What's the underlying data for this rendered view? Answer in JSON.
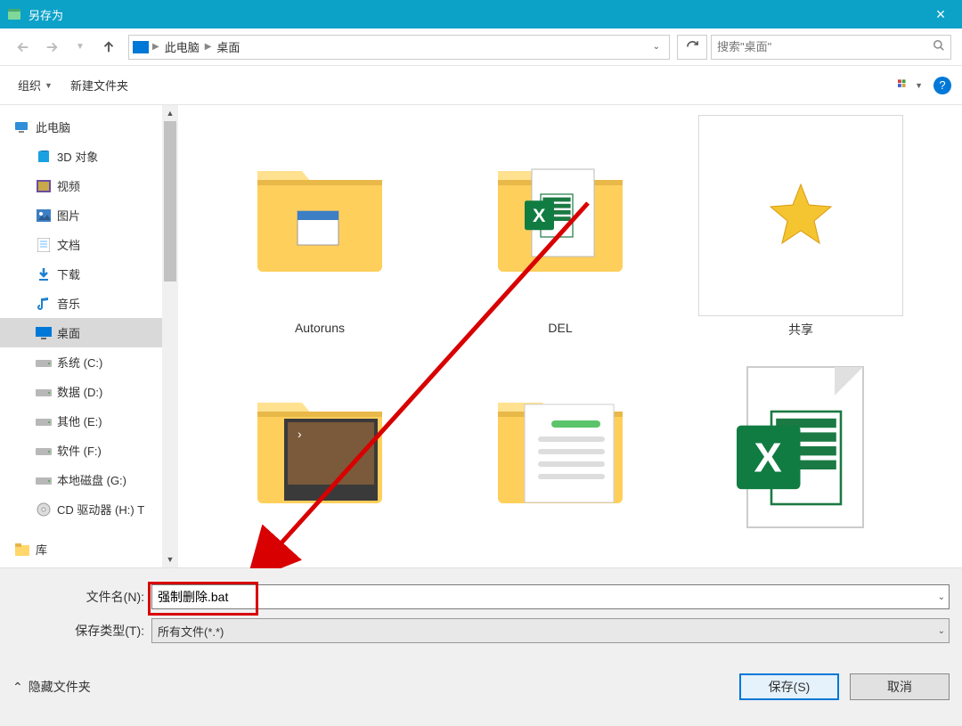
{
  "window": {
    "title": "另存为",
    "close": "×"
  },
  "nav": {
    "crumbs": [
      "此电脑",
      "桌面"
    ],
    "search_placeholder": "搜索\"桌面\""
  },
  "toolbar": {
    "organize": "组织",
    "new_folder": "新建文件夹"
  },
  "tree": [
    {
      "label": "此电脑",
      "icon": "pc",
      "indent": 0
    },
    {
      "label": "3D 对象",
      "icon": "3d",
      "indent": 1
    },
    {
      "label": "视频",
      "icon": "video",
      "indent": 1
    },
    {
      "label": "图片",
      "icon": "picture",
      "indent": 1
    },
    {
      "label": "文档",
      "icon": "document",
      "indent": 1
    },
    {
      "label": "下载",
      "icon": "download",
      "indent": 1
    },
    {
      "label": "音乐",
      "icon": "music",
      "indent": 1
    },
    {
      "label": "桌面",
      "icon": "desktop",
      "indent": 1,
      "selected": true
    },
    {
      "label": "系统 (C:)",
      "icon": "drive",
      "indent": 1
    },
    {
      "label": "数据 (D:)",
      "icon": "drive",
      "indent": 1
    },
    {
      "label": "其他 (E:)",
      "icon": "drive",
      "indent": 1
    },
    {
      "label": "软件 (F:)",
      "icon": "drive",
      "indent": 1
    },
    {
      "label": "本地磁盘 (G:)",
      "icon": "drive",
      "indent": 1
    },
    {
      "label": "CD 驱动器 (H:) T",
      "icon": "cd",
      "indent": 1
    },
    {
      "label": "库",
      "icon": "lib",
      "indent": 0
    }
  ],
  "files": [
    {
      "name": "Autoruns",
      "type": "folder-app"
    },
    {
      "name": "DEL",
      "type": "folder-excel"
    },
    {
      "name": "共享",
      "type": "star"
    },
    {
      "name": "",
      "type": "folder-image"
    },
    {
      "name": "",
      "type": "folder-doc"
    },
    {
      "name": "",
      "type": "excel"
    }
  ],
  "form": {
    "filename_label": "文件名(N):",
    "filename_value": "强制删除.bat",
    "filetype_label": "保存类型(T):",
    "filetype_value": "所有文件(*.*)"
  },
  "actions": {
    "hide_folders": "隐藏文件夹",
    "save": "保存(S)",
    "cancel": "取消"
  }
}
